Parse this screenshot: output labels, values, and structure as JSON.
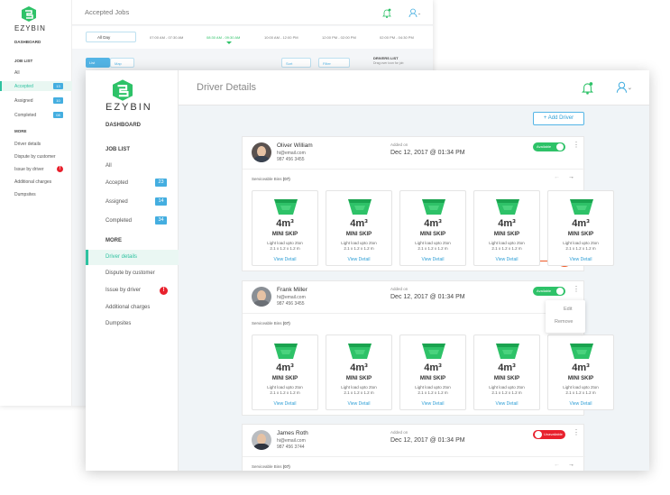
{
  "back": {
    "brand": "EZYBIN",
    "dashboard": "DASHBOARD",
    "job_list": "JOB LIST",
    "items": [
      {
        "label": "All"
      },
      {
        "label": "Accepted",
        "count": "13"
      },
      {
        "label": "Assigned",
        "count": "10"
      },
      {
        "label": "Completed",
        "count": "08"
      }
    ],
    "more": "MORE",
    "more_items": [
      "Driver details",
      "Dispute by customer",
      "Issue by driver",
      "Additional charges",
      "Dumpsites"
    ],
    "issue_badge": "!",
    "title": "Accepted Jobs",
    "date_select": "All Day",
    "slots": [
      "07:00 AM - 07:30 AM",
      "08:30 AM - 09:30 AM",
      "10:00 AM - 12:00 PM",
      "12:00 PM - 02:00 PM",
      "02:00 PM - 04:30 PM"
    ],
    "list_label": "List",
    "map_label": "Map",
    "sort_label": "Sort",
    "filter_label": "Filter",
    "drivers_list": "DRIVERS LIST",
    "drivers_sub": "Drag over icon for job"
  },
  "front": {
    "brand": "EZYBIN",
    "dashboard": "DASHBOARD",
    "job_list": "JOB LIST",
    "items": [
      {
        "label": "All"
      },
      {
        "label": "Accepted",
        "count": "23"
      },
      {
        "label": "Assigned",
        "count": "14"
      },
      {
        "label": "Completed",
        "count": "34"
      }
    ],
    "more": "MORE",
    "more_items": [
      "Driver details",
      "Dispute by customer",
      "Issue by driver",
      "Additional charges",
      "Dumpsites"
    ],
    "issue_badge": "!",
    "title": "Driver Details",
    "add_driver": "+ Add Driver",
    "added_on_label": "Added on",
    "serviceable_label": "Serviceable Bins",
    "serviceable_count": "(07)",
    "drivers": [
      {
        "name": "Oliver William",
        "email": "hi@email.com",
        "phone": "987 456 3455",
        "added_on": "Dec 12, 2017 @ 01:34 PM",
        "status": "Available"
      },
      {
        "name": "Frank Miller",
        "email": "hi@email.com",
        "phone": "987 456 3455",
        "added_on": "Dec 12, 2017 @ 01:34 PM",
        "status": "Available"
      },
      {
        "name": "James Roth",
        "email": "hi@email.com",
        "phone": "987 456 3744",
        "added_on": "Dec 12, 2017 @ 01:34 PM",
        "status": "Unavailable"
      }
    ],
    "bin": {
      "size": "4m³",
      "name": "MINI SKIP",
      "desc1": "Light load upto 2ton",
      "desc2": "2.1 x 1.2 x 1.2 m",
      "view": "View Detail"
    },
    "popup": {
      "edit": "Edit",
      "remove": "Remove"
    },
    "cursor_badge": "12c"
  },
  "colors": {
    "accent": "#2ec2a0",
    "green": "#2ec268",
    "blue": "#44aee0",
    "red": "#e8212d"
  }
}
